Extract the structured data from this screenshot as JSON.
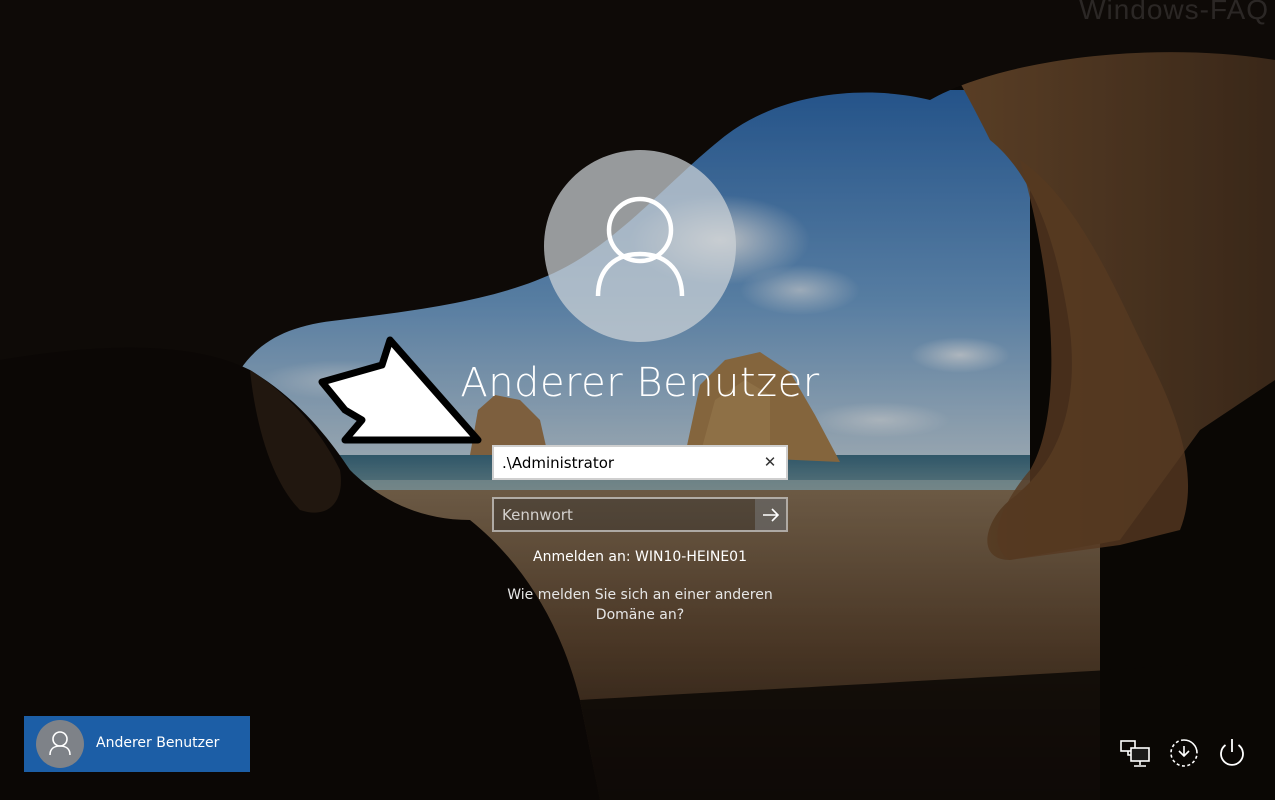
{
  "watermark": "Windows-FAQ",
  "login": {
    "user_name": "Anderer Benutzer",
    "username_value": ".\\Administrator",
    "password_placeholder": "Kennwort",
    "signin_target": "Anmelden an: WIN10-HEINE01",
    "other_domain_line1": "Wie melden Sie sich an einer anderen",
    "other_domain_line2": "Domäne an?"
  },
  "user_switcher": {
    "tiles": [
      {
        "label": "Anderer Benutzer"
      }
    ]
  },
  "system_buttons": [
    "network-icon",
    "ease-of-access-icon",
    "power-icon"
  ],
  "colors": {
    "tile_accent": "#1c5ea6",
    "input_background": "#ffffff"
  }
}
